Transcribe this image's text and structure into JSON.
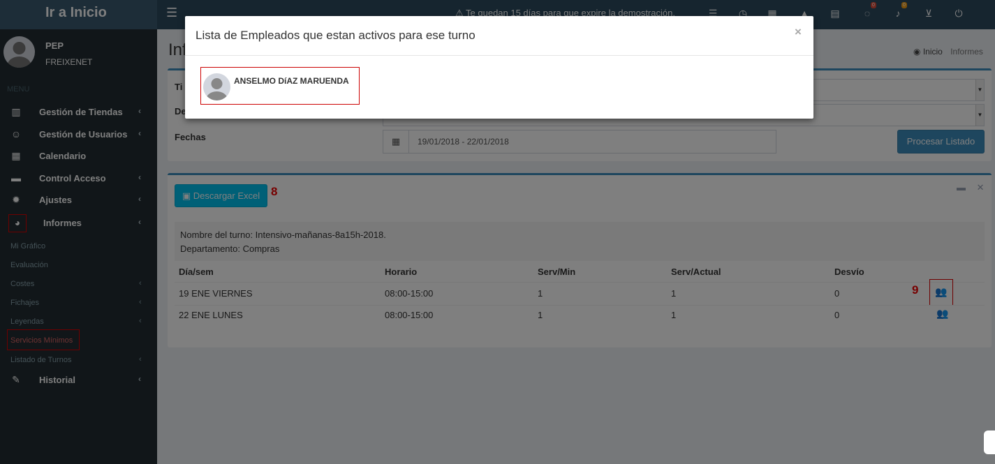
{
  "topbar": {
    "brand": "Ir a Inicio",
    "menu_toggle_icon": "bars-icon",
    "notice": "⚠ Te quedan 15 días para que expire la demostración.",
    "icons": [
      "list-icon",
      "clock-icon",
      "calendar-icon",
      "road-icon",
      "newspaper-icon",
      "comments-icon",
      "bell-icon",
      "cart-icon",
      "power-icon"
    ],
    "comments_badge": "0",
    "bell_badge": "0"
  },
  "sidebar": {
    "user_name": "PEP",
    "user_company": "FREIXENET",
    "menu_header": "MENU",
    "items": [
      {
        "label": "Gestión de Tiendas",
        "icon": "building-icon"
      },
      {
        "label": "Gestión de Usuarios",
        "icon": "smile-icon"
      },
      {
        "label": "Calendario",
        "icon": "calendar-icon"
      },
      {
        "label": "Control Acceso",
        "icon": "credit-card-icon"
      },
      {
        "label": "Ajustes",
        "icon": "gear-icon"
      },
      {
        "label": "Informes",
        "icon": "pie-chart-icon"
      },
      {
        "label": "Historial",
        "icon": "edit-icon"
      }
    ],
    "subitems": [
      "Mi Gráfico",
      "Evaluación",
      "Costes",
      "Fichajes",
      "Leyendas",
      "Servicios Mínimos",
      "Listado de Turnos"
    ]
  },
  "page": {
    "title": "Inf",
    "breadcrumb_home": "Inicio",
    "breadcrumb_current": "Informes"
  },
  "filters": {
    "label_tienda": "Ti",
    "label_depto": "De",
    "label_fechas": "Fechas",
    "date_range": "19/01/2018 - 22/01/2018",
    "process_button": "Procesar Listado"
  },
  "report": {
    "excel_button": "Descargar Excel",
    "marker_8": "8",
    "marker_9": "9",
    "shift_name": "Nombre del turno: Intensivo-mañanas-8a15h-2018.",
    "department": "Departamento: Compras",
    "columns": [
      "Día/sem",
      "Horario",
      "Serv/Min",
      "Serv/Actual",
      "Desvío"
    ],
    "rows": [
      {
        "day": "19 ENE VIERNES",
        "horario": "08:00-15:00",
        "serv_min": "1",
        "serv_actual": "1",
        "desvio": "0"
      },
      {
        "day": "22 ENE LUNES",
        "horario": "08:00-15:00",
        "serv_min": "1",
        "serv_actual": "1",
        "desvio": "0"
      }
    ]
  },
  "modal": {
    "title": "Lista de Empleados que estan activos para ese turno",
    "close": "×",
    "employee_name": "ANSELMO DíAZ MARUENDA"
  }
}
